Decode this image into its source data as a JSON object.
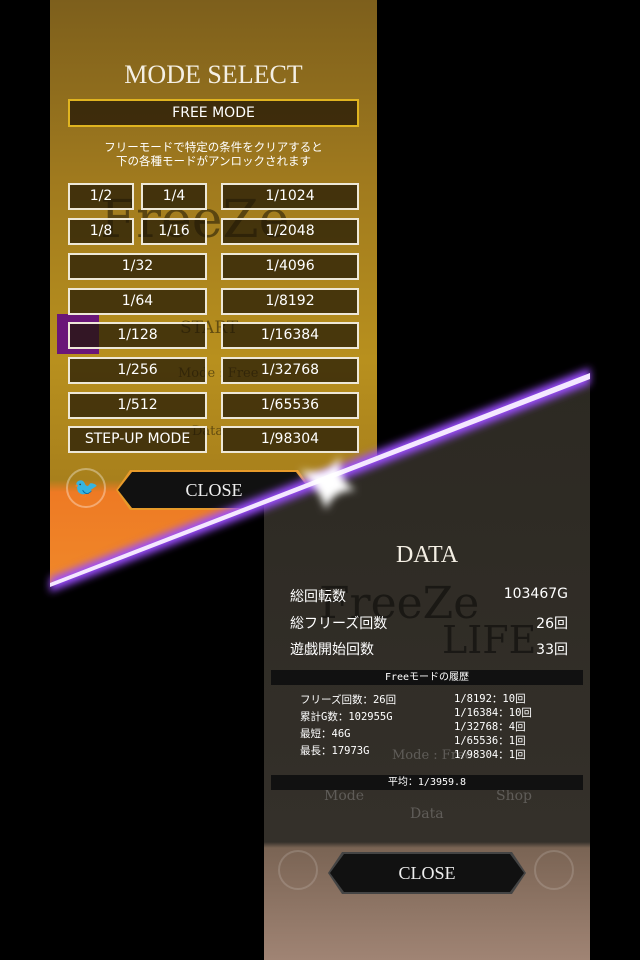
{
  "mode_select": {
    "title": "MODE SELECT",
    "free_mode": "FREE MODE",
    "description_line1": "フリーモードで特定の条件をクリアすると",
    "description_line2": "下の各種モードがアンロックされます",
    "buttons_left": [
      "1/2",
      "1/4",
      "1/8",
      "1/16",
      "1/32",
      "1/64",
      "1/128",
      "1/256",
      "1/512",
      "STEP-UP MODE"
    ],
    "buttons_right": [
      "1/1024",
      "1/2048",
      "1/4096",
      "1/8192",
      "1/16384",
      "1/32768",
      "1/65536",
      "1/98304"
    ],
    "close": "CLOSE"
  },
  "background": {
    "logo_top": "FreeZe",
    "logo_bottom": "LIFE",
    "start": "START",
    "mode_label": "Mode : Free",
    "nav_mode": "Mode",
    "nav_shop": "Shop",
    "nav_data": "Data"
  },
  "data": {
    "title": "DATA",
    "stats": [
      {
        "label": "総回転数",
        "value": "103467G"
      },
      {
        "label": "総フリーズ回数",
        "value": "26回"
      },
      {
        "label": "遊戯開始回数",
        "value": "33回"
      }
    ],
    "history_header": "Freeモードの履歴",
    "history_left": [
      "フリーズ回数：26回",
      "累計G数：102955G",
      "最短：46G",
      "最長：17973G"
    ],
    "history_right": [
      "1/8192：10回",
      "1/16384：10回",
      "1/32768：4回",
      "1/65536：1回",
      "1/98304：1回"
    ],
    "average": "平均：1/3959.8",
    "close": "CLOSE"
  },
  "colors": {
    "free_mode_border": "#e0b420",
    "slash": "#9b4dff",
    "accent_orange": "#f08a2a"
  }
}
